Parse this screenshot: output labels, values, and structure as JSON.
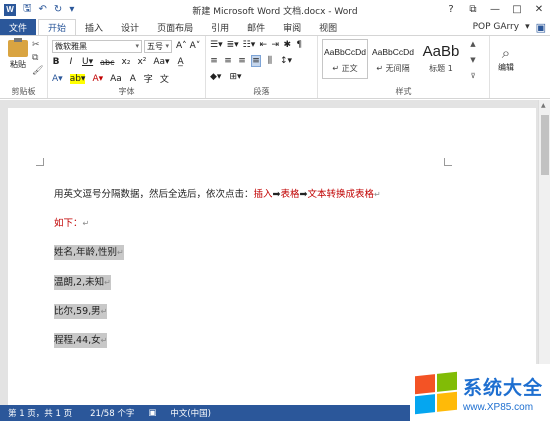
{
  "titlebar": {
    "title": "新建 Microsoft Word 文档.docx - Word",
    "app_icon": "W",
    "save_icon": "🖫",
    "undo_icon": "↶",
    "redo_icon": "↻",
    "customize_icon": "▾",
    "help": "?",
    "ribbon_display": "⧉",
    "minimize": "—",
    "restore": "□",
    "close": "✕"
  },
  "tabs": [
    "文件",
    "开始",
    "插入",
    "设计",
    "页面布局",
    "引用",
    "邮件",
    "审阅",
    "视图"
  ],
  "user": {
    "name": "POP GArry",
    "dropdown": "▾",
    "avatar": "▣"
  },
  "ribbon": {
    "clipboard": {
      "paste": "粘贴",
      "label": "剪贴板"
    },
    "font": {
      "font_name": "微软雅黑",
      "font_size": "五号",
      "row1": [
        "A˄",
        "A˅",
        "Aa▾",
        "A̲",
        "文"
      ],
      "row2": [
        "B",
        "I",
        "U▾",
        "abc",
        "x₂",
        "x²"
      ],
      "row3": [
        "A▾",
        "ab▾",
        "A▾",
        "Aa",
        "A",
        "字"
      ],
      "label": "字体"
    },
    "paragraph": {
      "row1": [
        "☰▾",
        "≣▾",
        "☷▾",
        "⇤",
        "⇥",
        "✱",
        "¶"
      ],
      "row2": [
        "≡",
        "≡",
        "≡",
        "≡",
        "⫼",
        "↕▾"
      ],
      "row3": [
        "◆▾",
        "⊞▾"
      ],
      "label": "段落"
    },
    "styles": {
      "items": [
        {
          "preview": "AaBbCcDd",
          "name": "↵ 正文"
        },
        {
          "preview": "AaBbCcDd",
          "name": "↵ 无间隔"
        },
        {
          "preview": "AaBb",
          "name": "标题 1"
        }
      ],
      "label": "样式"
    },
    "editing": {
      "label": "编辑"
    }
  },
  "document": {
    "line1_part1": "用英文逗号分隔数据，然后全选后，依次点击：",
    "line1_insert": "插入",
    "line1_arrow1": "➡",
    "line1_table": "表格",
    "line1_arrow2": "➡",
    "line1_convert": "文本转换成表格",
    "line2": "如下：",
    "rows": [
      "姓名,年龄,性别",
      "温朗,2,未知",
      "比尔,59,男",
      "程程,44,女"
    ],
    "para_mark": "↵"
  },
  "status": {
    "page": "第 1 页，共 1 页",
    "words": "21/58 个字",
    "proofing_icon": "▣",
    "language": "中文(中国)"
  },
  "watermark": {
    "name": "系统大全",
    "url": "www.XP85.com"
  },
  "colors": {
    "accent": "#2b579a",
    "red": "#c00000"
  }
}
